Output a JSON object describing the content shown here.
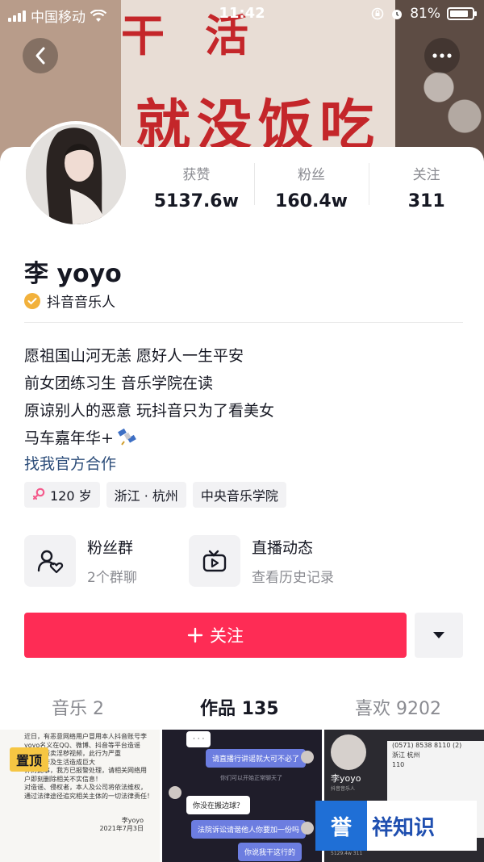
{
  "status_bar": {
    "carrier": "中国移动",
    "time": "11:42",
    "battery": "81%"
  },
  "banner": {
    "sign_top": "干活",
    "sign_mid": "就没饭吃"
  },
  "profile": {
    "name": "李 yoyo",
    "verified_label": "抖音音乐人",
    "stats": [
      {
        "label": "获赞",
        "value": "5137.6w"
      },
      {
        "label": "粉丝",
        "value": "160.4w"
      },
      {
        "label": "关注",
        "value": "311"
      }
    ],
    "bio": [
      "愿祖国山河无恙 愿好人一生平安",
      "前女团练习生 音乐学院在读",
      "原谅别人的恶意 玩抖音只为了看美女",
      "马车嘉年华+"
    ],
    "official_link": "找我官方合作",
    "tags": [
      "120 岁",
      "浙江 · 杭州",
      "中央音乐学院"
    ]
  },
  "features": {
    "fans_group": {
      "title": "粉丝群",
      "subtitle": "2个群聊"
    },
    "live": {
      "title": "直播动态",
      "subtitle": "查看历史记录"
    }
  },
  "actions": {
    "follow_label": "关注"
  },
  "tabs": [
    {
      "label": "音乐 2",
      "active": false
    },
    {
      "label": "作品 135",
      "active": true
    },
    {
      "label": "喜欢 9202",
      "active": false
    }
  ],
  "thumbnails": {
    "pinned_label": "置顶",
    "doc_lines": [
      "近日，有恶意网络用户冒用本人抖音账号李",
      "yoyo名义在QQ、微博、抖音等平台造谣",
      "直播、贩卖淫秽视频，此行为严重",
      "本人工作及生活造成巨大",
      "",
      "针对此事，我方已报警处理，请相关网络用",
      "户即刻删除相关不实信息！",
      "对造谣、侵权者，本人及公司将依法维权，",
      "通过法律途径追究相关主体的一切法律责任！"
    ],
    "doc_signature": "李yoyo",
    "doc_date": "2021年7月3日",
    "chat": {
      "b1": "请直播行讲谣就大可不必了",
      "hint": "你们可以开始正常聊天了",
      "b2": "你没在搬边球？",
      "b3": "法院诉讼请谐他人你要加一份吗",
      "b4": "你说我干这行的"
    },
    "mini_profile": {
      "name": "李yoyo",
      "sub": "抖音音乐人",
      "phone": "(0571) 8538 8110 (2)",
      "city": "浙江 杭州",
      "num": "110",
      "stats": "5129.4w  311"
    },
    "watermark": [
      "誉",
      "祥知识"
    ]
  }
}
